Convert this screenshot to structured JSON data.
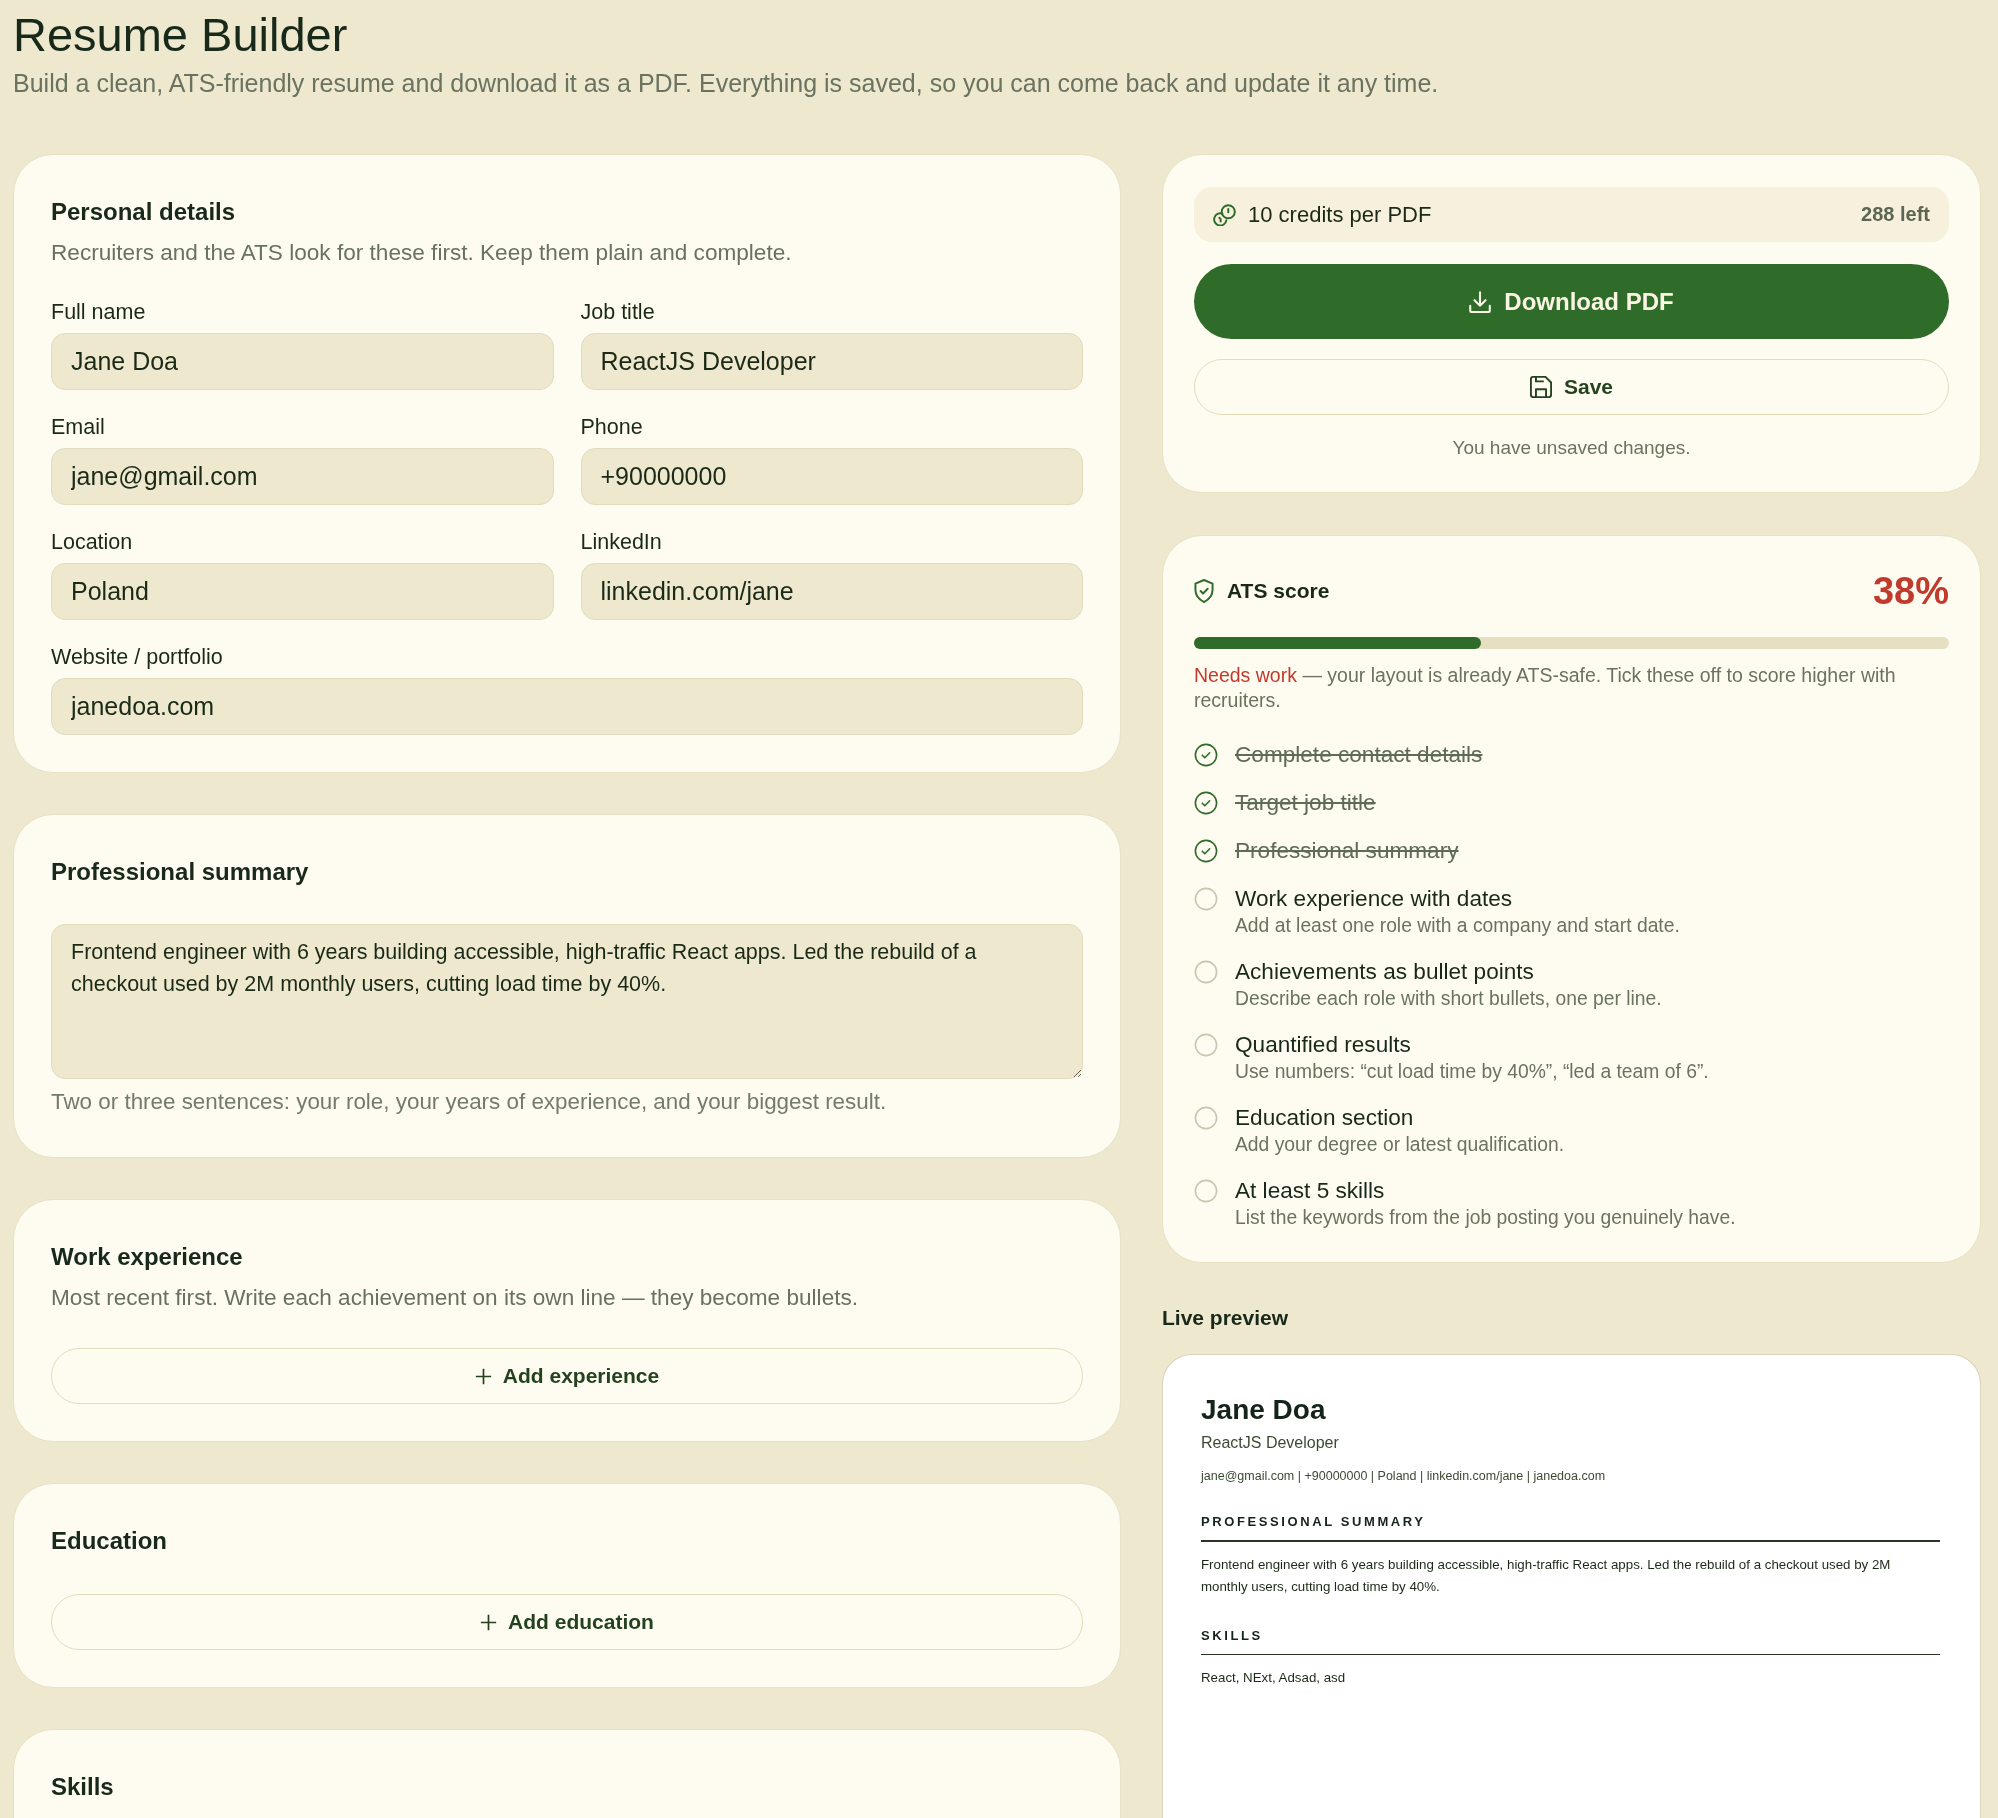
{
  "header": {
    "title": "Resume Builder",
    "subtitle": "Build a clean, ATS-friendly resume and download it as a PDF. Everything is saved, so you can come back and update it any time."
  },
  "personal_details": {
    "title": "Personal details",
    "description": "Recruiters and the ATS look for these first. Keep them plain and complete.",
    "fields": [
      {
        "label": "Full name",
        "value": "Jane Doa"
      },
      {
        "label": "Job title",
        "value": "ReactJS Developer"
      },
      {
        "label": "Email",
        "value": "jane@gmail.com"
      },
      {
        "label": "Phone",
        "value": "+90000000"
      },
      {
        "label": "Location",
        "value": "Poland"
      },
      {
        "label": "LinkedIn",
        "value": "linkedin.com/jane"
      },
      {
        "label": "Website / portfolio",
        "value": "janedoa.com"
      }
    ]
  },
  "professional_summary": {
    "title": "Professional summary",
    "value": "Frontend engineer with 6 years building accessible, high-traffic React apps. Led the rebuild of a checkout used by 2M monthly users, cutting load time by 40%.",
    "hint": "Two or three sentences: your role, your years of experience, and your biggest result."
  },
  "work_experience": {
    "title": "Work experience",
    "description": "Most recent first. Write each achievement on its own line — they become bullets.",
    "add_button": "Add experience"
  },
  "education": {
    "title": "Education",
    "add_button": "Add education"
  },
  "skills": {
    "title": "Skills"
  },
  "export": {
    "credits": {
      "label": "10 credits per PDF",
      "remaining": "288 left"
    },
    "download_button": "Download PDF",
    "save_button": "Save",
    "save_status": "You have unsaved changes."
  },
  "ats": {
    "title": "ATS score",
    "score": "38%",
    "level": 0.38,
    "status": "Needs work",
    "note": "— your layout is already ATS-safe. Tick these off to score higher with recruiters.",
    "checklist": [
      {
        "label": "Complete contact details",
        "checked": true
      },
      {
        "label": "Target job title",
        "checked": true
      },
      {
        "label": "Professional summary",
        "checked": true
      },
      {
        "label": "Work experience with dates",
        "hint": "Add at least one role with a company and start date.",
        "checked": false
      },
      {
        "label": "Achievements as bullet points",
        "hint": "Describe each role with short bullets, one per line.",
        "checked": false
      },
      {
        "label": "Quantified results",
        "hint": "Use numbers: “cut load time by 40%”, “led a team of 6”.",
        "checked": false
      },
      {
        "label": "Education section",
        "hint": "Add your degree or latest qualification.",
        "checked": false
      },
      {
        "label": "At least 5 skills",
        "hint": "List the keywords from the job posting you genuinely have.",
        "checked": false
      }
    ]
  },
  "preview": {
    "title": "Live preview",
    "name": "Jane Doa",
    "job_title": "ReactJS Developer",
    "contact": "jane@gmail.com | +90000000 | Poland | linkedin.com/jane | janedoa.com",
    "sections": [
      {
        "heading": "PROFESSIONAL SUMMARY",
        "body": "Frontend engineer with 6 years building accessible, high-traffic React apps. Led the rebuild of a checkout used by 2M monthly users, cutting load time by 40%."
      },
      {
        "heading": "SKILLS",
        "body": "React, NExt, Adsad, asd"
      }
    ]
  }
}
